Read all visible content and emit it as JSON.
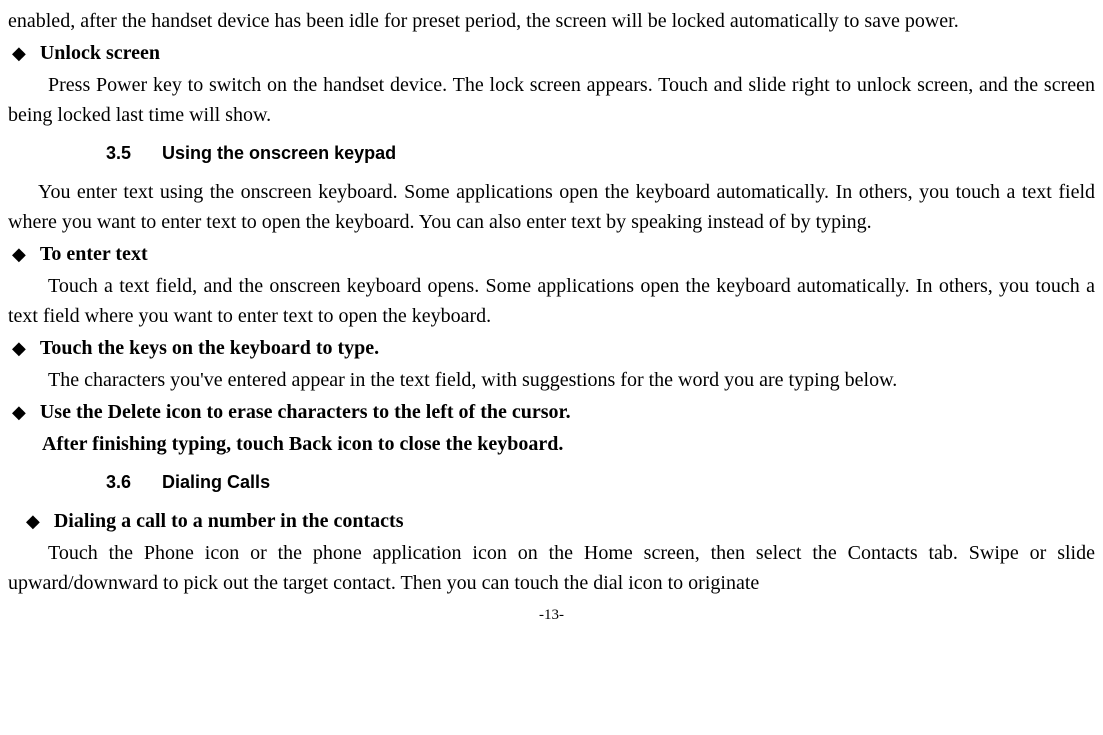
{
  "intro_para": "enabled, after the handset device has been idle for preset period, the screen will be locked automatically to save power.",
  "bullet1": "Unlock screen",
  "para1": "Press Power key to switch on the handset device. The lock screen appears. Touch and slide right to unlock screen, and the screen being locked last time will show.",
  "sec35_num": "3.5",
  "sec35_title": "Using the onscreen keypad",
  "para2": "You enter text using the onscreen keyboard. Some applications open the keyboard automatically. In others, you touch a text field where you want to enter text to open the keyboard. You can also enter text by speaking instead of by typing.",
  "bullet2": "To enter text",
  "para3": "Touch a text field, and the onscreen keyboard opens. Some applications open the keyboard automatically. In others, you touch a text field where you want to enter text to open the keyboard.",
  "bullet3": "Touch the keys on the keyboard to type.",
  "para4": "The characters you've entered appear in the text field, with suggestions for the word you are typing below.",
  "bullet4": "Use the Delete icon to erase characters to the left of the cursor.",
  "para5": "After finishing typing, touch Back icon to close the keyboard.",
  "sec36_num": "3.6",
  "sec36_title": "Dialing Calls",
  "bullet5": "Dialing a call to a number in the contacts",
  "para6": "Touch the Phone icon or the phone application icon on the Home screen, then select the Contacts tab. Swipe or slide upward/downward to pick out the target contact. Then you can touch the dial icon to originate",
  "page_num": "-13-"
}
